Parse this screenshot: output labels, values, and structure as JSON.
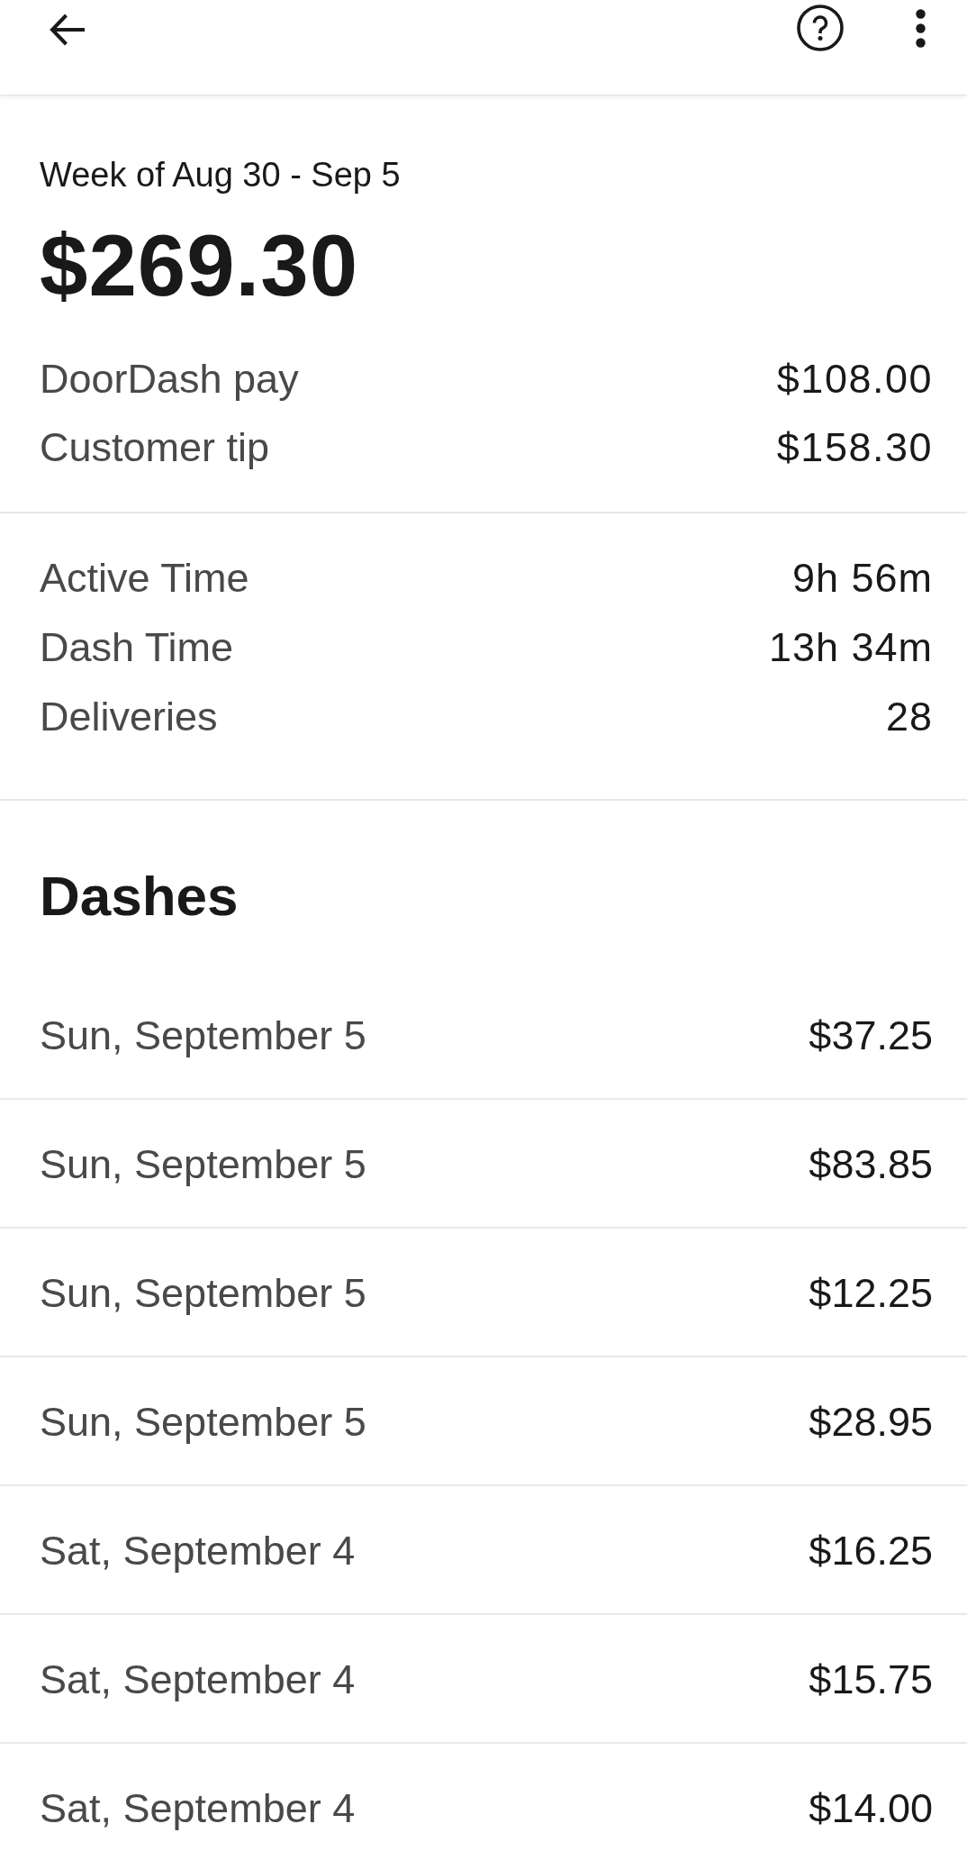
{
  "summary": {
    "period": "Week of Aug 30 - Sep 5",
    "total": "$269.30",
    "breakdown": [
      {
        "label": "DoorDash pay",
        "amount": "$108.00"
      },
      {
        "label": "Customer tip",
        "amount": "$158.30"
      }
    ]
  },
  "stats": [
    {
      "label": "Active Time",
      "value": "9h 56m"
    },
    {
      "label": "Dash Time",
      "value": "13h 34m"
    },
    {
      "label": "Deliveries",
      "value": "28"
    }
  ],
  "dashes": {
    "title": "Dashes",
    "rows": [
      {
        "date": "Sun, September 5",
        "amount": "$37.25"
      },
      {
        "date": "Sun, September 5",
        "amount": "$83.85"
      },
      {
        "date": "Sun, September 5",
        "amount": "$12.25"
      },
      {
        "date": "Sun, September 5",
        "amount": "$28.95"
      },
      {
        "date": "Sat, September 4",
        "amount": "$16.25"
      },
      {
        "date": "Sat, September 4",
        "amount": "$15.75"
      },
      {
        "date": "Sat, September 4",
        "amount": "$14.00"
      }
    ]
  }
}
